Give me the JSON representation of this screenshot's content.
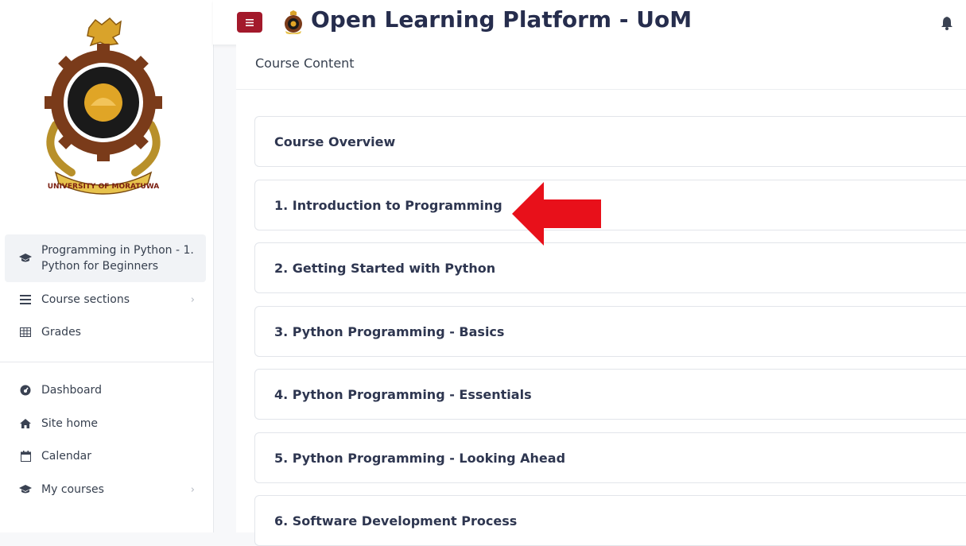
{
  "header": {
    "app_title": "Open Learning Platform - UoM",
    "menu_icon": "hamburger-icon",
    "notification_icon": "bell-icon",
    "accent_color": "#a3192b",
    "title_color": "#262d4d"
  },
  "sidebar": {
    "logo_icon": "university-of-moratuwa-crest",
    "logo_text": "UNIVERSITY OF MORATUWA",
    "course_items": [
      {
        "label": "Programming in Python - 1. Python for Beginners",
        "icon": "graduation-cap-icon",
        "active": true
      },
      {
        "label": "Course sections",
        "icon": "list-icon",
        "has_submenu": true
      },
      {
        "label": "Grades",
        "icon": "table-icon"
      }
    ],
    "site_items": [
      {
        "label": "Dashboard",
        "icon": "dashboard-icon"
      },
      {
        "label": "Site home",
        "icon": "home-icon"
      },
      {
        "label": "Calendar",
        "icon": "calendar-icon"
      },
      {
        "label": "My courses",
        "icon": "graduation-cap-icon",
        "has_submenu": true
      }
    ]
  },
  "main": {
    "heading": "Course Content",
    "sections": [
      "Course Overview",
      "1. Introduction to Programming",
      "2. Getting Started with Python",
      "3. Python Programming - Basics",
      "4. Python Programming - Essentials",
      "5. Python Programming - Looking Ahead",
      "6. Software Development Process"
    ],
    "highlight_arrow_color": "#e8101a"
  }
}
